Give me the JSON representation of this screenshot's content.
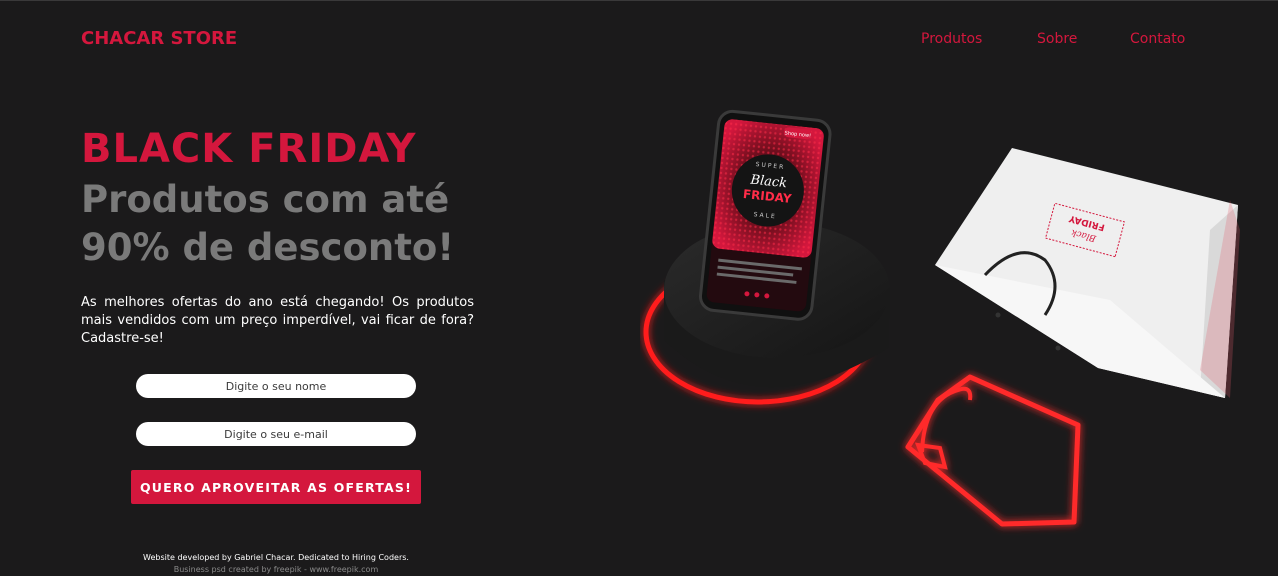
{
  "brand": {
    "name": "CHACAR STORE"
  },
  "nav": {
    "items": [
      "Produtos",
      "Sobre",
      "Contato"
    ]
  },
  "hero": {
    "title": "BLACK FRIDAY",
    "subtitle_line1": "Produtos com até",
    "subtitle_line2": "90% de desconto!",
    "description": "As melhores ofertas do ano está chegando! Os produtos mais vendidos com um preço imperdível, vai ficar de fora? Cadastre-se!"
  },
  "form": {
    "name_placeholder": "Digite o seu nome",
    "email_placeholder": "Digite o seu e-mail",
    "submit_label": "QUERO APROVEITAR AS OFERTAS!"
  },
  "phone_screen": {
    "badge": "Shop now!",
    "top_word": "SUPER",
    "script_word": "Black",
    "main_word": "FRIDAY",
    "bottom_word": "SALE"
  },
  "bag": {
    "script_word": "Black",
    "main_word": "FRIDAY"
  },
  "footer": {
    "credit_line1": "Website developed by Gabriel Chacar. Dedicated to Hiring Coders.",
    "credit_line2": "Business psd created by freepik - www.freepik.com"
  },
  "colors": {
    "background": "#1b1a1b",
    "accent": "#d4173d",
    "muted_text": "#7a7a7a",
    "neon": "#ff2a2a"
  },
  "icons": [
    "neon-shopping-bag-icon"
  ]
}
